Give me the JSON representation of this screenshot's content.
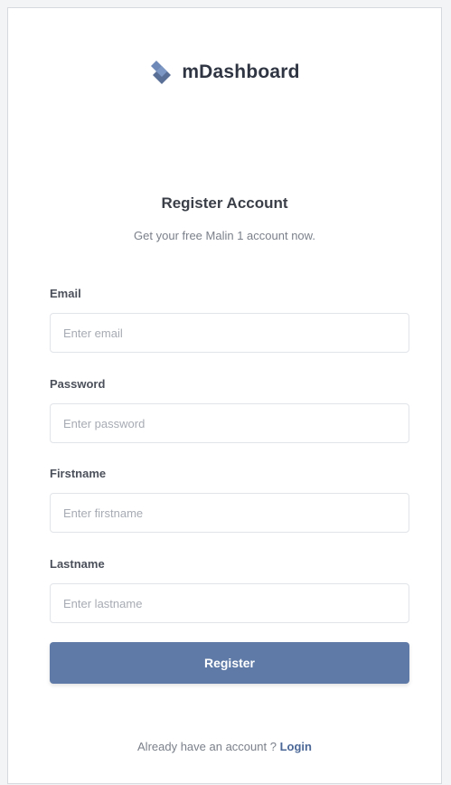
{
  "brand": {
    "name": "mDashboard",
    "logo_icon": "diamond-logo-icon",
    "colors": {
      "logo_primary": "#596f96",
      "logo_secondary": "#6e88b8"
    }
  },
  "header": {
    "title": "Register Account",
    "subtitle": "Get your free Malin 1 account now."
  },
  "form": {
    "email": {
      "label": "Email",
      "placeholder": "Enter email",
      "value": ""
    },
    "password": {
      "label": "Password",
      "placeholder": "Enter password",
      "value": ""
    },
    "firstname": {
      "label": "Firstname",
      "placeholder": "Enter firstname",
      "value": ""
    },
    "lastname": {
      "label": "Lastname",
      "placeholder": "Enter lastname",
      "value": ""
    },
    "submit_label": "Register",
    "submit_color": "#5f7aa6"
  },
  "footer": {
    "prompt": "Already have an account ?",
    "login_link": "Login",
    "link_color": "#4a6796"
  }
}
